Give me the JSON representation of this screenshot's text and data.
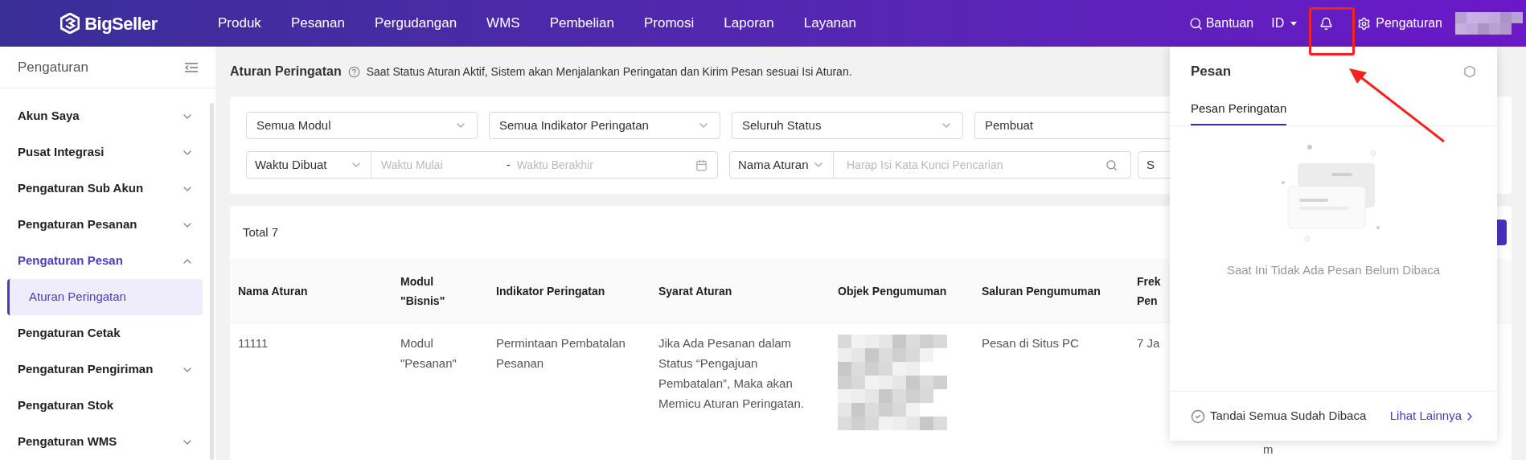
{
  "header": {
    "logo": "BigSeller",
    "nav": [
      {
        "label": "Produk"
      },
      {
        "label": "Pesanan"
      },
      {
        "label": "Pergudangan"
      },
      {
        "label": "WMS"
      },
      {
        "label": "Pembelian"
      },
      {
        "label": "Promosi"
      },
      {
        "label": "Laporan"
      },
      {
        "label": "Layanan"
      }
    ],
    "help": "Bantuan",
    "language": "ID",
    "settings": "Pengaturan"
  },
  "sidebar": {
    "title": "Pengaturan",
    "items": [
      {
        "label": "Akun Saya",
        "kind": "group",
        "expanded": false,
        "selected": false
      },
      {
        "label": "Pusat Integrasi",
        "kind": "group",
        "expanded": false,
        "selected": false
      },
      {
        "label": "Pengaturan Sub Akun",
        "kind": "group",
        "expanded": false,
        "selected": false
      },
      {
        "label": "Pengaturan Pesanan",
        "kind": "group",
        "expanded": false,
        "selected": false
      },
      {
        "label": "Pengaturan Pesan",
        "kind": "group",
        "expanded": true,
        "selected": true,
        "children": [
          {
            "label": "Aturan Peringatan",
            "selected": true
          }
        ]
      },
      {
        "label": "Pengaturan Cetak",
        "kind": "link",
        "selected": false
      },
      {
        "label": "Pengaturan Pengiriman",
        "kind": "group",
        "expanded": false,
        "selected": false
      },
      {
        "label": "Pengaturan Stok",
        "kind": "link",
        "selected": false
      },
      {
        "label": "Pengaturan WMS",
        "kind": "group",
        "expanded": false,
        "selected": false
      }
    ]
  },
  "page": {
    "title": "Aturan Peringatan",
    "hint": "Saat Status Aturan Aktif, Sistem akan Menjalankan Peringatan dan Kirim Pesan sesuai Isi Aturan."
  },
  "filters": {
    "selects": [
      "Semua Modul",
      "Semua Indikator Peringatan",
      "Seluruh Status",
      "Pembuat"
    ],
    "date_type": "Waktu Dibuat",
    "start_placeholder": "Waktu Mulai",
    "separator": "-",
    "end_placeholder": "Waktu Berakhir",
    "search_type": "Nama Aturan",
    "search_placeholder": "Harap Isi Kata Kunci Pencarian",
    "select_5": "S"
  },
  "table": {
    "total": "Total 7",
    "columns": [
      "Nama Aturan",
      "Modul \"Bisnis\"",
      "Indikator Peringatan",
      "Syarat Aturan",
      "Objek Pengumuman",
      "Saluran Pengumuman",
      "Frek Pen"
    ],
    "rows": [
      {
        "name": "11111",
        "module": "Modul \"Pesanan\"",
        "indicator": "Permintaan Pembatalan Pesanan",
        "condition": "Jika Ada Pesanan dalam Status “Pengajuan Pembatalan”, Maka akan Memicu Aturan Peringatan.",
        "channel": "Pesan di Situs PC",
        "column_7": "7 Ja",
        "column_7_more": "m"
      }
    ]
  },
  "popup": {
    "title": "Pesan",
    "tabs": [
      {
        "label": "Pesan Peringatan",
        "selected": true
      }
    ],
    "empty_text": "Saat Ini Tidak Ada Pesan Belum Dibaca",
    "mark_all": "Tandai Semua Sudah Dibaca",
    "more": "Lihat Lainnya"
  }
}
